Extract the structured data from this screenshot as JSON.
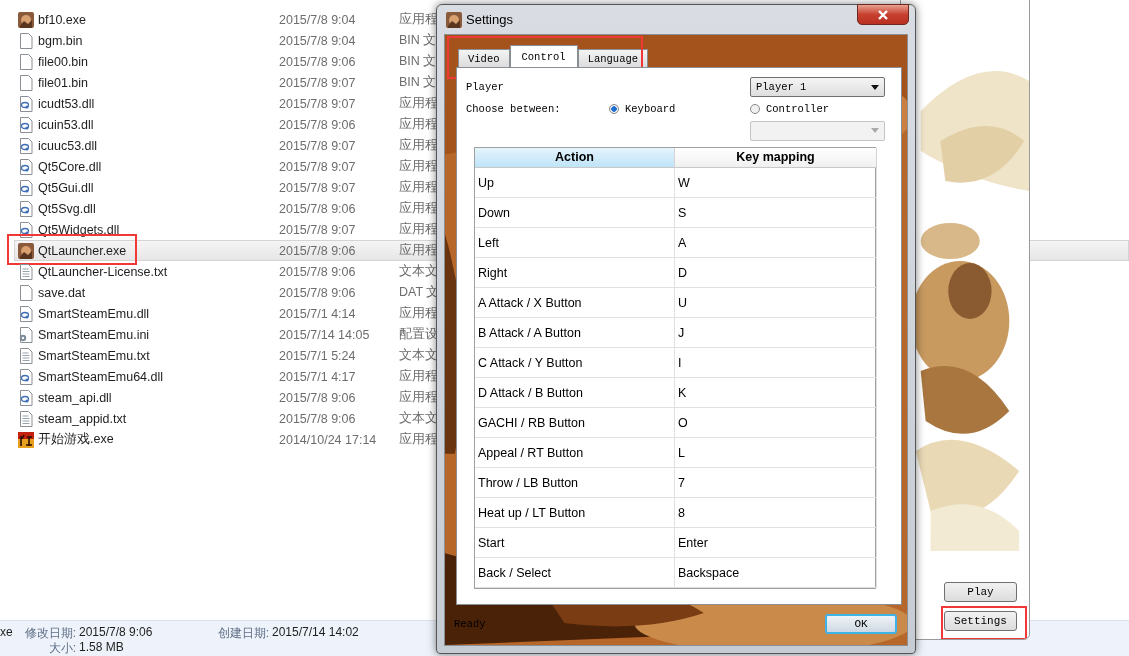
{
  "explorer": {
    "files": [
      {
        "name": "bf10.exe",
        "date": "2015/7/8 9:04",
        "type": "应用程",
        "kind": "exe",
        "selected": false,
        "highlighted": false
      },
      {
        "name": "bgm.bin",
        "date": "2015/7/8 9:04",
        "type": "BIN 文",
        "kind": "blank",
        "selected": false,
        "highlighted": false
      },
      {
        "name": "file00.bin",
        "date": "2015/7/8 9:06",
        "type": "BIN 文",
        "kind": "blank",
        "selected": false,
        "highlighted": false
      },
      {
        "name": "file01.bin",
        "date": "2015/7/8 9:07",
        "type": "BIN 文",
        "kind": "blank",
        "selected": false,
        "highlighted": false
      },
      {
        "name": "icudt53.dll",
        "date": "2015/7/8 9:07",
        "type": "应用程",
        "kind": "dll",
        "selected": false,
        "highlighted": false
      },
      {
        "name": "icuin53.dll",
        "date": "2015/7/8 9:06",
        "type": "应用程",
        "kind": "dll",
        "selected": false,
        "highlighted": false
      },
      {
        "name": "icuuc53.dll",
        "date": "2015/7/8 9:07",
        "type": "应用程",
        "kind": "dll",
        "selected": false,
        "highlighted": false
      },
      {
        "name": "Qt5Core.dll",
        "date": "2015/7/8 9:07",
        "type": "应用程",
        "kind": "dll",
        "selected": false,
        "highlighted": false
      },
      {
        "name": "Qt5Gui.dll",
        "date": "2015/7/8 9:07",
        "type": "应用程",
        "kind": "dll",
        "selected": false,
        "highlighted": false
      },
      {
        "name": "Qt5Svg.dll",
        "date": "2015/7/8 9:06",
        "type": "应用程",
        "kind": "dll",
        "selected": false,
        "highlighted": false
      },
      {
        "name": "Qt5Widgets.dll",
        "date": "2015/7/8 9:07",
        "type": "应用程",
        "kind": "dll",
        "selected": false,
        "highlighted": false
      },
      {
        "name": "QtLauncher.exe",
        "date": "2015/7/8 9:06",
        "type": "应用程",
        "kind": "exe",
        "selected": true,
        "highlighted": true
      },
      {
        "name": "QtLauncher-License.txt",
        "date": "2015/7/8 9:06",
        "type": "文本文",
        "kind": "text",
        "selected": false,
        "highlighted": false
      },
      {
        "name": "save.dat",
        "date": "2015/7/8 9:06",
        "type": "DAT 文",
        "kind": "blank",
        "selected": false,
        "highlighted": false
      },
      {
        "name": "SmartSteamEmu.dll",
        "date": "2015/7/1 4:14",
        "type": "应用程",
        "kind": "dll",
        "selected": false,
        "highlighted": false
      },
      {
        "name": "SmartSteamEmu.ini",
        "date": "2015/7/14 14:05",
        "type": "配置设",
        "kind": "ini",
        "selected": false,
        "highlighted": false
      },
      {
        "name": "SmartSteamEmu.txt",
        "date": "2015/7/1 5:24",
        "type": "文本文",
        "kind": "text",
        "selected": false,
        "highlighted": false
      },
      {
        "name": "SmartSteamEmu64.dll",
        "date": "2015/7/1 4:17",
        "type": "应用程",
        "kind": "dll",
        "selected": false,
        "highlighted": false
      },
      {
        "name": "steam_api.dll",
        "date": "2015/7/8 9:06",
        "type": "应用程",
        "kind": "dll",
        "selected": false,
        "highlighted": false
      },
      {
        "name": "steam_appid.txt",
        "date": "2015/7/8 9:06",
        "type": "文本文",
        "kind": "text",
        "selected": false,
        "highlighted": false
      },
      {
        "name": "开始游戏.exe",
        "date": "2014/10/24 17:14",
        "type": "应用程",
        "kind": "game",
        "selected": false,
        "highlighted": false
      }
    ],
    "details": {
      "name": "xe",
      "modified_label": "修改日期:",
      "modified": "2015/7/8 9:06",
      "created_label": "创建日期:",
      "created": "2015/7/14 14:02",
      "size_label": "大小:",
      "size": "1.58 MB"
    }
  },
  "launcher": {
    "buttons": [
      {
        "label": "Play",
        "highlighted": false
      },
      {
        "label": "Settings",
        "highlighted": true
      }
    ]
  },
  "dialog": {
    "title": "Settings",
    "tabs_highlighted": true,
    "tabs": [
      {
        "label": "Video",
        "selected": false
      },
      {
        "label": "Control",
        "selected": true
      },
      {
        "label": "Language",
        "selected": false
      }
    ],
    "player_label": "Player",
    "player_value": "Player 1",
    "choose_label": "Choose between:",
    "options": [
      {
        "label": "Keyboard",
        "selected": true
      },
      {
        "label": "Controller",
        "selected": false
      }
    ],
    "controller_combo": {
      "disabled": true
    },
    "table": {
      "columns": [
        {
          "label": "Action",
          "selected": true
        },
        {
          "label": "Key mapping",
          "selected": false
        }
      ],
      "rows": [
        [
          "Up",
          "W"
        ],
        [
          "Down",
          "S"
        ],
        [
          "Left",
          "A"
        ],
        [
          "Right",
          "D"
        ],
        [
          "A Attack / X Button",
          "U"
        ],
        [
          "B Attack / A Button",
          "J"
        ],
        [
          "C Attack / Y Button",
          "I"
        ],
        [
          "D Attack / B Button",
          "K"
        ],
        [
          "GACHI / RB Button",
          "O"
        ],
        [
          "Appeal / RT Button",
          "L"
        ],
        [
          "Throw / LB Button",
          "7"
        ],
        [
          "Heat up / LT Button",
          "8"
        ],
        [
          "Start",
          "Enter"
        ],
        [
          "Back / Select",
          "Backspace"
        ]
      ]
    },
    "status": "Ready",
    "ok_button": "OK"
  }
}
